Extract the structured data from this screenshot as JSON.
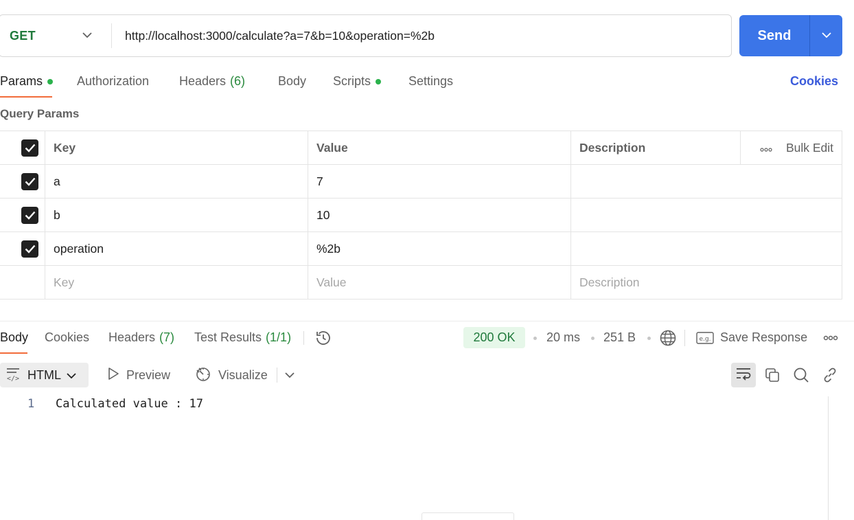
{
  "request": {
    "method": "GET",
    "url": "http://localhost:3000/calculate?a=7&b=10&operation=%2b",
    "send_label": "Send"
  },
  "request_tabs": {
    "params": "Params",
    "authorization": "Authorization",
    "headers": "Headers",
    "headers_count": "(6)",
    "body": "Body",
    "scripts": "Scripts",
    "settings": "Settings",
    "cookies": "Cookies"
  },
  "query_params": {
    "title": "Query Params",
    "headers": {
      "key": "Key",
      "value": "Value",
      "description": "Description",
      "bulk_edit": "Bulk Edit"
    },
    "rows": [
      {
        "key": "a",
        "value": "7",
        "description": ""
      },
      {
        "key": "b",
        "value": "10",
        "description": ""
      },
      {
        "key": "operation",
        "value": "%2b",
        "description": ""
      }
    ],
    "placeholders": {
      "key": "Key",
      "value": "Value",
      "description": "Description"
    }
  },
  "response_tabs": {
    "body": "Body",
    "cookies": "Cookies",
    "headers": "Headers",
    "headers_count": "(7)",
    "test_results": "Test Results",
    "test_results_count": "(1/1)"
  },
  "response_meta": {
    "status": "200 OK",
    "time": "20 ms",
    "size": "251 B",
    "save_response": "Save Response"
  },
  "body_toolbar": {
    "format": "HTML",
    "preview": "Preview",
    "visualize": "Visualize"
  },
  "response_body": {
    "line_number": "1",
    "line_text": "Calculated value : 17"
  },
  "colors": {
    "accent": "#3b75e8",
    "method_get": "#207a3c",
    "tab_underline": "#f26b3a",
    "status_ok_bg": "#e6f7e9"
  }
}
